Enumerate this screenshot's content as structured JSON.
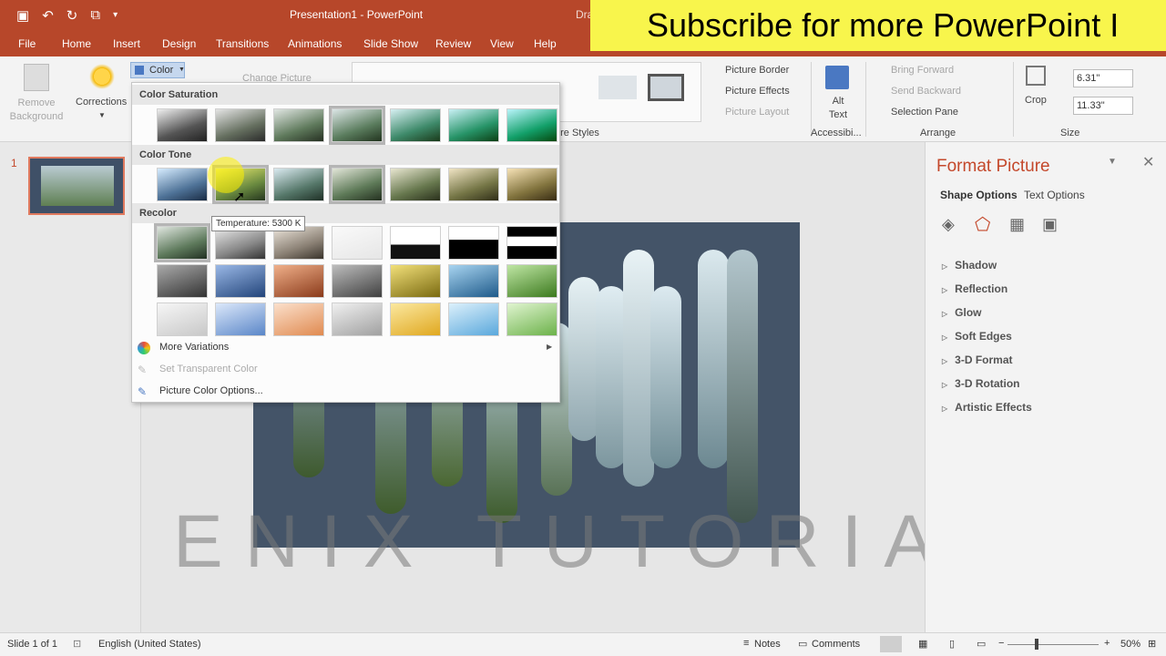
{
  "titlebar": {
    "title": "Presentation1  -  PowerPoint",
    "context": "Dra"
  },
  "banner": {
    "text": "Subscribe for more PowerPoint I"
  },
  "tabs": [
    "File",
    "Home",
    "Insert",
    "Design",
    "Transitions",
    "Animations",
    "Slide Show",
    "Review",
    "View",
    "Help"
  ],
  "ribbon": {
    "remove_bg": "Remove Background",
    "corrections": "Corrections",
    "color": "Color",
    "change_picture": "Change Picture",
    "picture_border": "Picture Border",
    "picture_effects": "Picture Effects",
    "picture_layout": "Picture Layout",
    "styles_group": "ure Styles",
    "alt_text": "Alt Text",
    "accessibility": "Accessibi...",
    "bring_forward": "Bring Forward",
    "send_backward": "Send Backward",
    "selection_pane": "Selection Pane",
    "arrange": "Arrange",
    "crop": "Crop",
    "height": "6.31\"",
    "width": "11.33\"",
    "size": "Size"
  },
  "dropdown": {
    "saturation": "Color Saturation",
    "tone": "Color Tone",
    "recolor": "Recolor",
    "tooltip": "Temperature: 5300 K",
    "more_variations": "More Variations",
    "set_transparent": "Set Transparent Color",
    "picture_color_options": "Picture Color Options..."
  },
  "slide_number": "1",
  "watermark": "ENIX TUTORIAL",
  "format_pane": {
    "title": "Format Picture",
    "shape_options": "Shape Options",
    "text_options": "Text Options",
    "items": [
      "Shadow",
      "Reflection",
      "Glow",
      "Soft Edges",
      "3-D Format",
      "3-D Rotation",
      "Artistic Effects"
    ]
  },
  "status": {
    "slide": "Slide 1 of 1",
    "language": "English (United States)",
    "notes": "Notes",
    "comments": "Comments",
    "zoom": "50%"
  },
  "colors": {
    "accent": "#b7472a",
    "banner": "#f8f54c",
    "slide_bg": "#445468"
  }
}
